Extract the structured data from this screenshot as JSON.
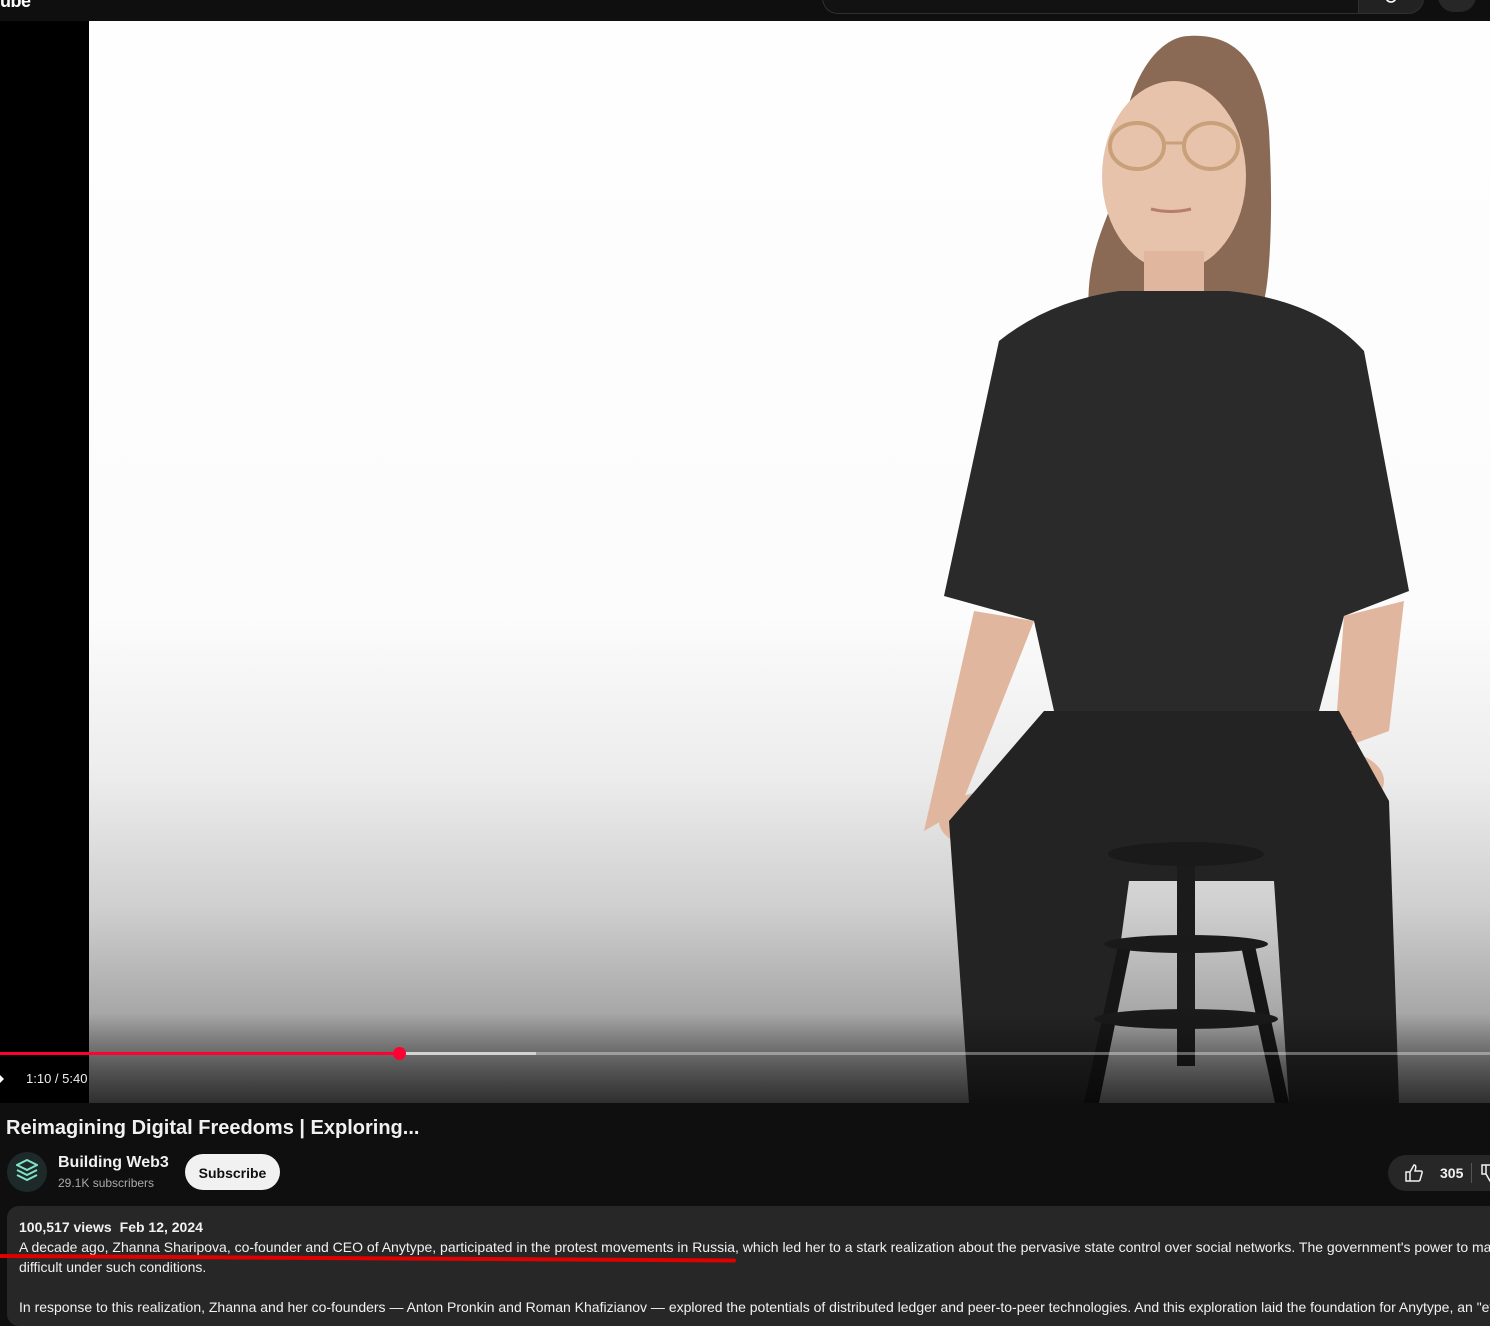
{
  "header": {
    "logo_fragment": "ube"
  },
  "player": {
    "time_display": "1:10 / 5:40",
    "progress_fraction": 0.268,
    "buffered_fraction": 0.36,
    "colors": {
      "progress": "#ff0033"
    }
  },
  "video": {
    "title": "Reimagining Digital Freedoms | Exploring..."
  },
  "channel": {
    "name": "Building Web3",
    "subscribers": "29.1K subscribers",
    "subscribe_label": "Subscribe"
  },
  "actions": {
    "like_count": "305",
    "icons": [
      "thumbs-up-icon",
      "thumbs-down-icon"
    ]
  },
  "description": {
    "views": "100,517 views",
    "date": "Feb 12, 2024",
    "line1": "A decade ago, Zhanna Sharipova, co-founder and CEO of Anytype, participated in the protest movements in Russia, which led her to a stark realization about the pervasive state control over social networks. The government's power to man",
    "line2": "difficult under such conditions.",
    "line3": "In response to this realization, Zhanna and her co-founders — Anton Pronkin and Roman Khafizianov — explored the potentials of distributed ledger and peer-to-peer technologies. And this exploration laid the foundation for Anytype, an \"eve"
  }
}
